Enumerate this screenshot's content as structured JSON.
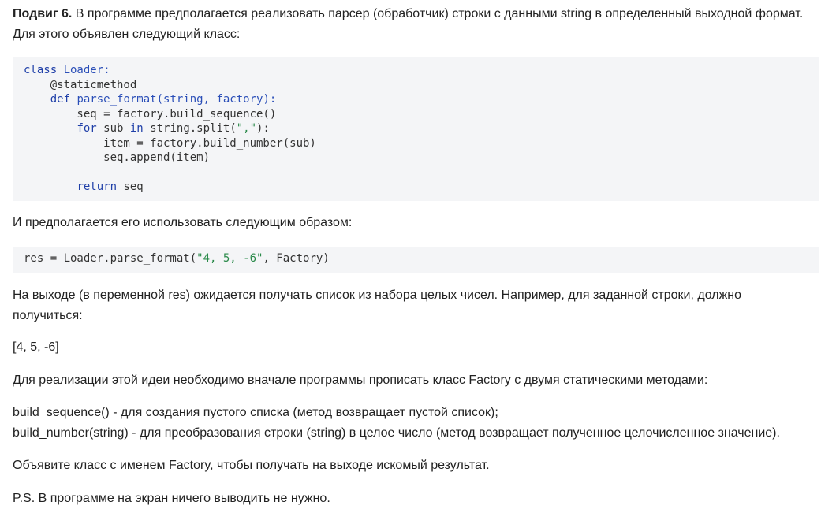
{
  "task": {
    "label": "Подвиг 6.",
    "intro_line1": " В программе предполагается реализовать парсер (обработчик) строки с данными string в определенный выходной формат.",
    "intro_line2": "Для этого объявлен следующий класс:"
  },
  "code_class": {
    "lines": [
      [
        {
          "t": "class ",
          "c": "kw"
        },
        {
          "t": "Loader:",
          "c": "fn"
        }
      ],
      [
        {
          "t": "    @staticmethod",
          "c": "dec"
        }
      ],
      [
        {
          "t": "    ",
          "c": ""
        },
        {
          "t": "def ",
          "c": "kw"
        },
        {
          "t": "parse_format(string, factory):",
          "c": "fn"
        }
      ],
      [
        {
          "t": "        seq = factory.build_sequence()",
          "c": ""
        }
      ],
      [
        {
          "t": "        ",
          "c": ""
        },
        {
          "t": "for ",
          "c": "kw"
        },
        {
          "t": "sub ",
          "c": ""
        },
        {
          "t": "in ",
          "c": "kw"
        },
        {
          "t": "string.split(",
          "c": ""
        },
        {
          "t": "\",\"",
          "c": "str"
        },
        {
          "t": "):",
          "c": ""
        }
      ],
      [
        {
          "t": "            item = factory.build_number(sub)",
          "c": ""
        }
      ],
      [
        {
          "t": "            seq.append(item)",
          "c": ""
        }
      ],
      [
        {
          "t": "",
          "c": ""
        }
      ],
      [
        {
          "t": "        ",
          "c": ""
        },
        {
          "t": "return ",
          "c": "kw"
        },
        {
          "t": "seq",
          "c": ""
        }
      ]
    ]
  },
  "usage_intro": "И предполагается его использовать следующим образом:",
  "code_usage": {
    "lines": [
      [
        {
          "t": "res = Loader.parse_format(",
          "c": ""
        },
        {
          "t": "\"4, 5, -6\"",
          "c": "str"
        },
        {
          "t": ", Factory)",
          "c": ""
        }
      ]
    ]
  },
  "output_text_line1": "На выходе (в переменной res) ожидается получать список из набора целых чисел. Например, для заданной строки, должно",
  "output_text_line2": "получиться:",
  "example_result": "[4, 5, -6]",
  "factory_intro": "Для реализации этой идеи необходимо вначале программы прописать класс Factory с двумя статическими методами:",
  "method_1": "build_sequence() - для создания пустого списка (метод возвращает пустой список);",
  "method_2": "build_number(string) - для преобразования строки (string) в целое число (метод возвращает полученное целочисленное значение).",
  "declare_text": "Объявите класс с именем Factory, чтобы получать на выходе искомый результат.",
  "ps_text": "P.S. В программе на экран ничего выводить не нужно."
}
